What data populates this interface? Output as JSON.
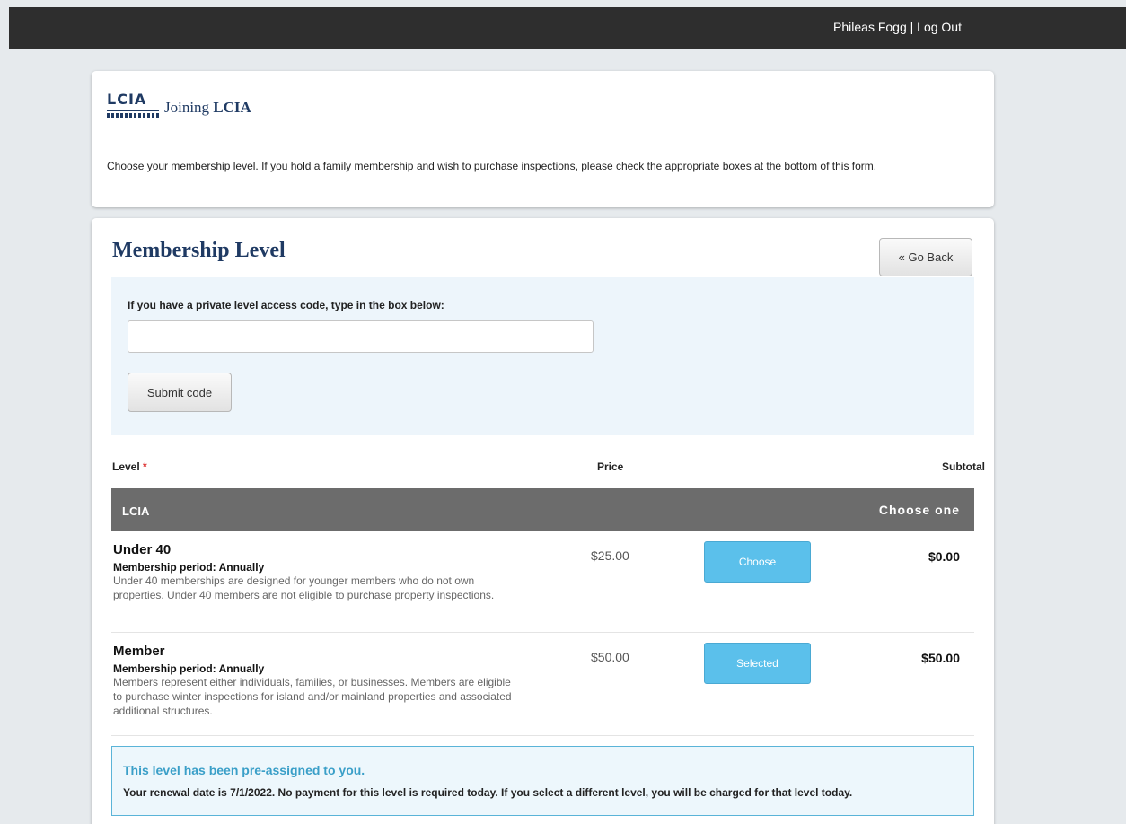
{
  "topbar": {
    "user_name": "Phileas Fogg",
    "separator": " | ",
    "logout_label": "Log Out"
  },
  "intro": {
    "logo_text": "LCIA",
    "title_prefix": "Joining ",
    "title_org": "LCIA",
    "instructions": "Choose your membership level. If you hold a family membership and wish to purchase inspections, please check the appropriate boxes at the bottom of this form."
  },
  "membership": {
    "title": "Membership Level",
    "go_back_label": "« Go Back",
    "access_code": {
      "label": "If you have a private level access code, type in the box below:",
      "value": "",
      "placeholder": "",
      "submit_label": "Submit code"
    },
    "columns": {
      "level": "Level",
      "required_mark": " *",
      "price": "Price",
      "subtotal": "Subtotal"
    },
    "group": {
      "name": "LCIA",
      "rule": "Choose one"
    },
    "levels": [
      {
        "name": "Under 40",
        "period": "Membership period: Annually",
        "description": "Under 40 memberships are designed for younger members who do not own properties. Under 40 members are not eligible to purchase property inspections.",
        "price": "$25.00",
        "button_label": "Choose",
        "subtotal": "$0.00"
      },
      {
        "name": "Member",
        "period": "Membership period: Annually",
        "description": "Members represent either individuals, families, or businesses. Members are eligible to purchase winter inspections for island and/or mainland properties and associated additional structures.",
        "price": "$50.00",
        "button_label": "Selected",
        "subtotal": "$50.00"
      }
    ],
    "notice": {
      "title": "This level has been pre-assigned to you.",
      "body": "Your renewal date is 7/1/2022. No payment for this level is required today. If you select a different level, you will be charged for that level today."
    }
  },
  "colors": {
    "topbar_bg": "#2e2e2e",
    "page_bg": "#e6eaed",
    "brand_navy": "#1f3a63",
    "button_blue": "#5bc0eb",
    "notice_blue": "#3a9fc8",
    "group_header_bg": "#6c6c6c"
  }
}
